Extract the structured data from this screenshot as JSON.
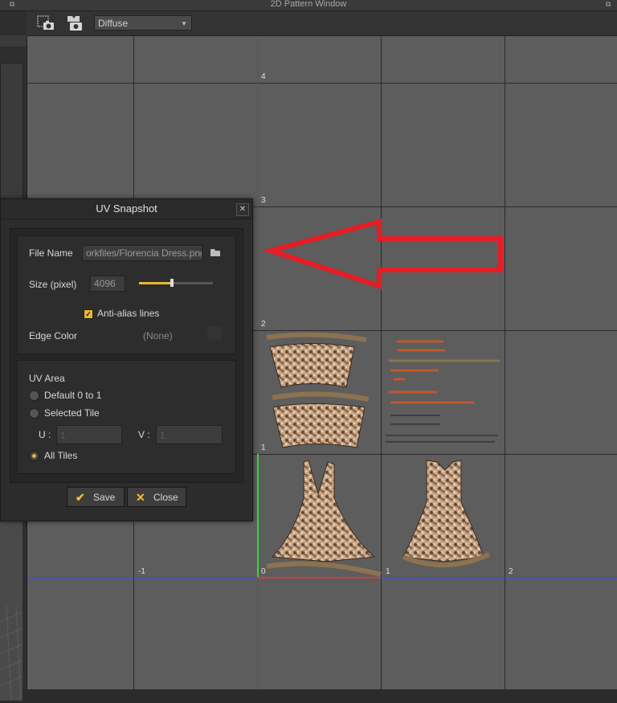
{
  "window": {
    "title": "2D Pattern Window"
  },
  "toolbar": {
    "icons": [
      "uv-snapshot-camera-icon",
      "texture-snapshot-camera-icon"
    ],
    "channel_select": "Diffuse"
  },
  "grid": {
    "x_labels": [
      "-1",
      "0",
      "1",
      "2"
    ],
    "y_labels": [
      "4",
      "3",
      "2",
      "1"
    ]
  },
  "dialog": {
    "title": "UV Snapshot",
    "file_name_label": "File Name",
    "file_name_value": "orkfiles/Florencia Dress.png",
    "size_label": "Size (pixel)",
    "size_value": "4096",
    "size_slider_level": 0.45,
    "antialias_label": "Anti-alias lines",
    "antialias_checked": true,
    "edge_color_label": "Edge Color",
    "edge_color_value": "(None)",
    "uv_area": {
      "title": "UV Area",
      "option_default": "Default 0 to 1",
      "option_selected_tile": "Selected Tile",
      "u_label": "U :",
      "u_value": "1",
      "v_label": "V :",
      "v_value": "1",
      "option_all_tiles": "All Tiles",
      "selected": "All Tiles"
    },
    "save_label": "Save",
    "close_label": "Close"
  },
  "colors": {
    "accent": "#e8b830",
    "annotation_arrow": "#e81c24",
    "axis_blue": "#3b4bd6",
    "axis_green": "#3bd63b",
    "axis_red": "#d63b3b"
  }
}
